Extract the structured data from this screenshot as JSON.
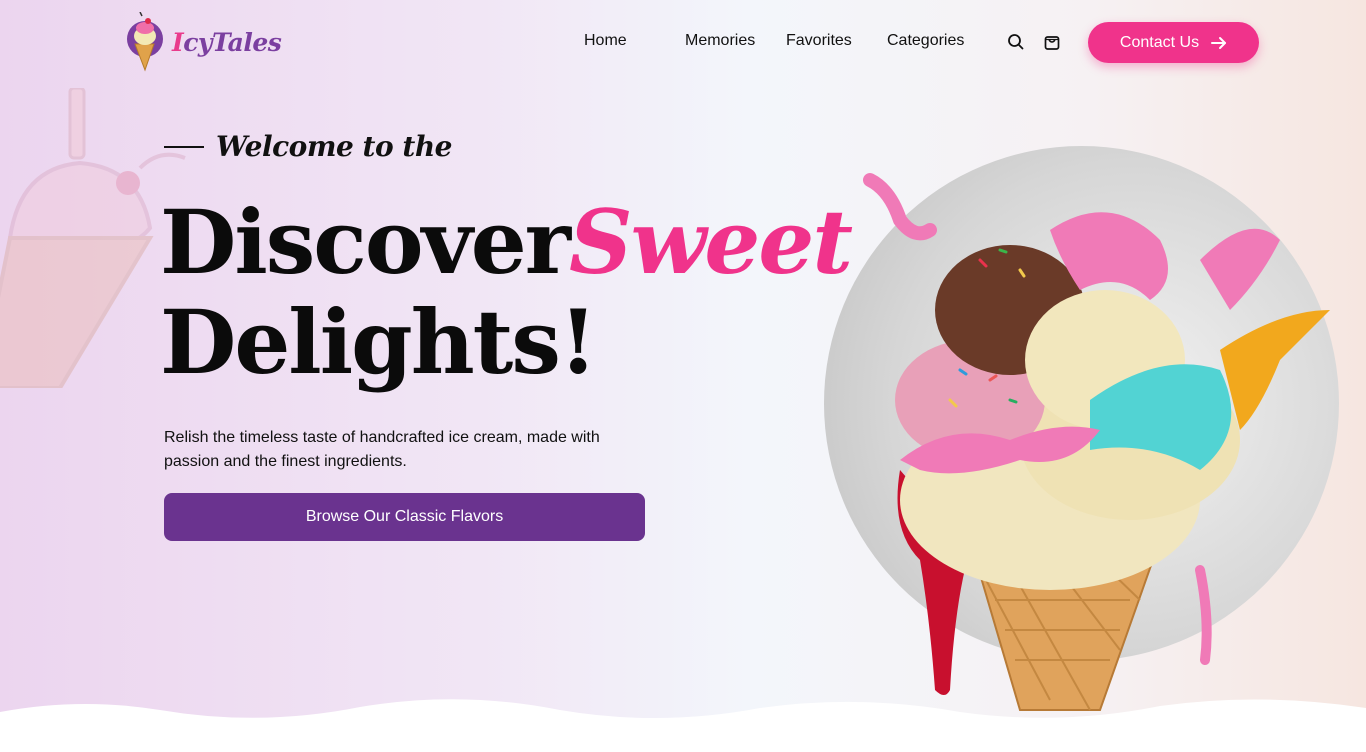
{
  "brand": {
    "name_first": "I",
    "name_rest": "cyTales"
  },
  "nav": {
    "items": [
      {
        "label": "Home"
      },
      {
        "label": "Memories"
      },
      {
        "label": "Favorites"
      },
      {
        "label": "Categories"
      }
    ],
    "search_icon": "search-icon",
    "cart_icon": "bag-icon",
    "contact_label": "Contact Us",
    "contact_icon": "arrow-right-icon"
  },
  "hero": {
    "welcome": "Welcome to the",
    "title_part1": "Discover",
    "title_part2": "Sweet",
    "title_line2": "Delights!",
    "description": "Relish the timeless taste of handcrafted ice cream, made with passion and the finest ingredients.",
    "cta_label": "Browse Our Classic Flavors"
  },
  "colors": {
    "accent_pink": "#f0338b",
    "accent_purple": "#6a338f",
    "text": "#111111"
  }
}
